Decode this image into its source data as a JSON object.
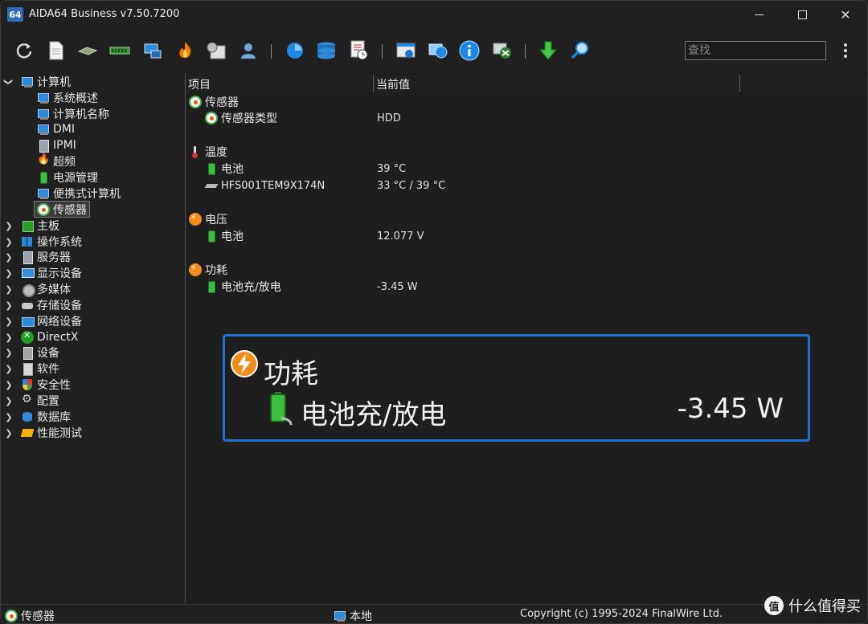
{
  "window": {
    "app_icon_text": "64",
    "title": "AIDA64 Business v7.50.7200"
  },
  "toolbar": {
    "icons": [
      "refresh-icon",
      "report-icon",
      "motherboard-icon",
      "memory-icon",
      "network-icon",
      "overclock-icon",
      "tools-icon",
      "user-icon",
      "cpuid-icon",
      "database-icon",
      "schedule-icon",
      "preferences-icon",
      "web-update-icon",
      "info-icon",
      "network-audit-icon",
      "download-icon",
      "search-icon"
    ],
    "search_placeholder": "查找"
  },
  "tree": {
    "items": [
      {
        "label": "计算机",
        "level": 0,
        "expanded": true,
        "icon": "computer-icon"
      },
      {
        "label": "系统概述",
        "level": 1,
        "icon": "computer-icon"
      },
      {
        "label": "计算机名称",
        "level": 1,
        "icon": "computer-icon"
      },
      {
        "label": "DMI",
        "level": 1,
        "icon": "computer-icon"
      },
      {
        "label": "IPMI",
        "level": 1,
        "icon": "server-icon"
      },
      {
        "label": "超频",
        "level": 1,
        "icon": "fire-icon"
      },
      {
        "label": "电源管理",
        "level": 1,
        "icon": "battery-icon"
      },
      {
        "label": "便携式计算机",
        "level": 1,
        "icon": "laptop-icon"
      },
      {
        "label": "传感器",
        "level": 1,
        "icon": "sensor-icon",
        "selected": true
      },
      {
        "label": "主板",
        "level": 0,
        "icon": "motherboard-icon"
      },
      {
        "label": "操作系统",
        "level": 0,
        "icon": "windows-icon"
      },
      {
        "label": "服务器",
        "level": 0,
        "icon": "server-icon"
      },
      {
        "label": "显示设备",
        "level": 0,
        "icon": "monitor-icon"
      },
      {
        "label": "多媒体",
        "level": 0,
        "icon": "multimedia-icon"
      },
      {
        "label": "存储设备",
        "level": 0,
        "icon": "storage-icon"
      },
      {
        "label": "网络设备",
        "level": 0,
        "icon": "network-icon"
      },
      {
        "label": "DirectX",
        "level": 0,
        "icon": "xbox-icon"
      },
      {
        "label": "设备",
        "level": 0,
        "icon": "devices-icon"
      },
      {
        "label": "软件",
        "level": 0,
        "icon": "software-icon"
      },
      {
        "label": "安全性",
        "level": 0,
        "icon": "security-shield-icon"
      },
      {
        "label": "配置",
        "level": 0,
        "icon": "config-icon"
      },
      {
        "label": "数据库",
        "level": 0,
        "icon": "database-icon"
      },
      {
        "label": "性能测试",
        "level": 0,
        "icon": "benchmark-icon"
      }
    ]
  },
  "list": {
    "headers": [
      "项目",
      "当前值"
    ],
    "rows": [
      {
        "label": "传感器",
        "value": "",
        "group": true,
        "icon": "sensor-icon"
      },
      {
        "label": "传感器类型",
        "value": "HDD",
        "icon": "sensor-icon"
      },
      {
        "label": "温度",
        "value": "",
        "group": true,
        "icon": "thermometer-icon"
      },
      {
        "label": "电池",
        "value": "39 °C",
        "icon": "battery-icon"
      },
      {
        "label": "HFS001TEM9X174N",
        "value": "33 °C / 39 °C",
        "icon": "disk-icon"
      },
      {
        "label": "电压",
        "value": "",
        "group": true,
        "icon": "voltage-icon"
      },
      {
        "label": "电池",
        "value": "12.077 V",
        "icon": "battery-icon"
      },
      {
        "label": "功耗",
        "value": "",
        "group": true,
        "icon": "power-icon"
      },
      {
        "label": "电池充/放电",
        "value": "-3.45 W",
        "icon": "battery-icon"
      }
    ]
  },
  "zoom": {
    "title": "功耗",
    "item": "电池充/放电",
    "value": "-3.45 W"
  },
  "status": {
    "left": "传感器",
    "middle": "本地",
    "right": "Copyright (c) 1995-2024 FinalWire Ltd."
  },
  "watermark": {
    "badge": "值",
    "text": "什么值得买"
  },
  "colors": {
    "accent_blue": "#1e6fd0",
    "background": "#202020"
  }
}
